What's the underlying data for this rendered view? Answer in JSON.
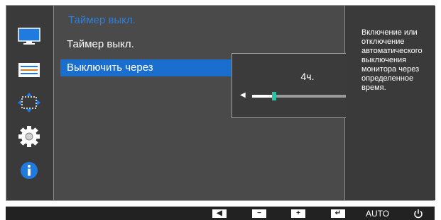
{
  "menu": {
    "title": "Таймер выкл.",
    "items": [
      {
        "label": "Таймер выкл."
      },
      {
        "label": "Выключить через"
      }
    ]
  },
  "popup": {
    "value": "4ч.",
    "slider_fraction": 0.2
  },
  "help": {
    "text": "Включение или отключение автоматического выключения монитора через определенное время."
  },
  "bottombar": {
    "auto_label": "AUTO"
  },
  "colors": {
    "accent": "#1a6fce",
    "title_blue": "#2f7fd8",
    "slider_thumb": "#2fbfa7"
  },
  "icons": {
    "sidebar": [
      "monitor-icon",
      "picture-settings-icon",
      "position-resize-icon",
      "settings-gear-icon",
      "info-icon"
    ],
    "bottom": [
      "left-arrow-icon",
      "minus-icon",
      "plus-icon",
      "enter-icon",
      "power-icon"
    ]
  }
}
